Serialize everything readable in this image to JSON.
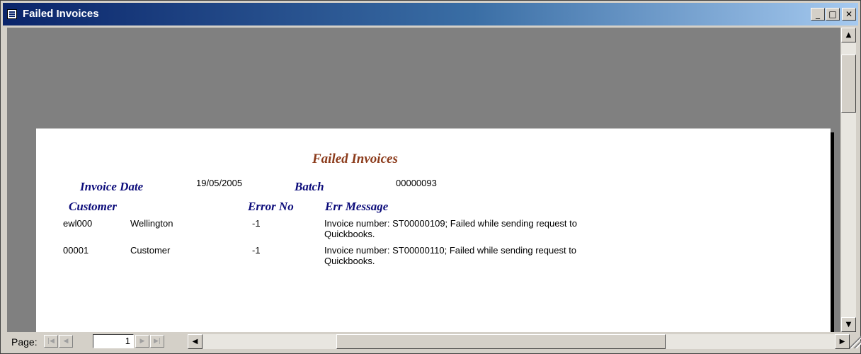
{
  "window": {
    "title": "Failed Invoices",
    "minimize_glyph": "_",
    "maximize_glyph": "□",
    "close_glyph": "✕"
  },
  "report": {
    "title": "Failed Invoices",
    "invoice_date_label": "Invoice Date",
    "invoice_date_value": "19/05/2005",
    "batch_label": "Batch",
    "batch_value": "00000093",
    "headers": {
      "customer": "Customer",
      "error_no": "Error No",
      "err_message": "Err Message"
    },
    "rows": [
      {
        "code": "ewl000",
        "name": "Wellington",
        "error_no": "-1",
        "message": "Invoice number: ST00000109; Failed while sending request to Quickbooks."
      },
      {
        "code": "00001",
        "name": "Customer",
        "error_no": "-1",
        "message": "Invoice number: ST00000110; Failed while sending request to Quickbooks."
      }
    ]
  },
  "navigation": {
    "page_label": "Page:",
    "page_value": "1",
    "first_icon": "first-record-icon",
    "prev_icon": "previous-record-icon",
    "next_icon": "next-record-icon",
    "last_icon": "last-record-icon"
  },
  "colors": {
    "title_bar_start": "#0a246a",
    "title_bar_end": "#a6caf0",
    "report_title": "#8b3a1a",
    "label_text": "#0b0b7a",
    "preview_background": "#808080"
  }
}
